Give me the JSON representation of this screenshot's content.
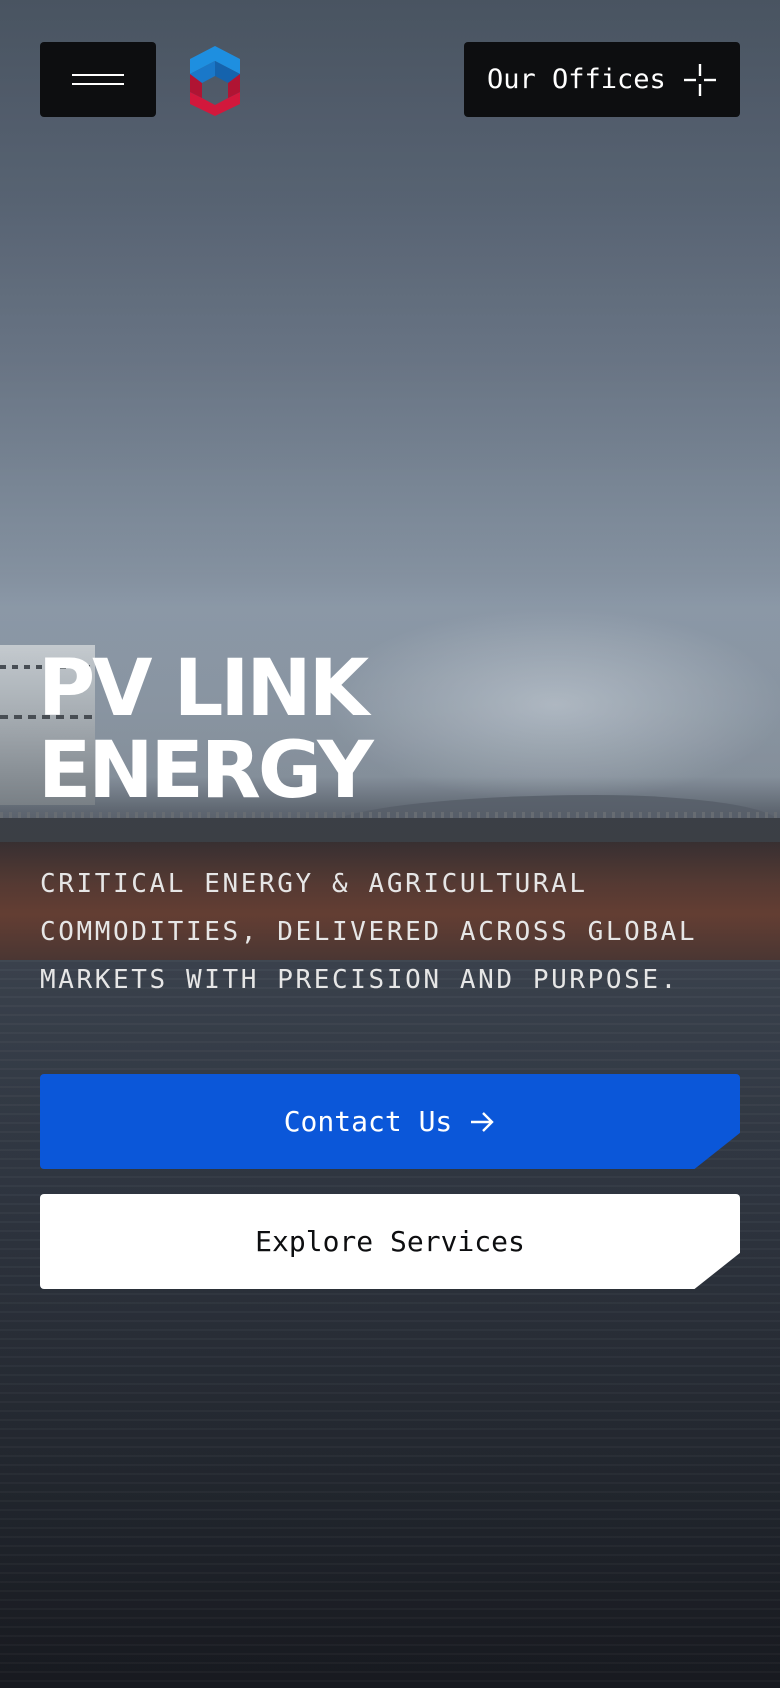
{
  "header": {
    "menu_icon": "hamburger-menu-icon",
    "logo_icon": "cube-logo-icon",
    "offices_label": "Our Offices",
    "offices_icon": "crosshair-icon"
  },
  "hero": {
    "title_line1": "PV LINK",
    "title_line2": "ENERGY",
    "subtitle_lines": [
      "CRITICAL ENERGY & AGRICULTURAL",
      "COMMODITIES, DELIVERED ACROSS GLOBAL",
      "MARKETS WITH PRECISION AND PURPOSE."
    ]
  },
  "actions": {
    "contact_label": "Contact Us",
    "contact_icon": "arrow-right-icon",
    "explore_label": "Explore Services"
  },
  "colors": {
    "primary_button": "#0b57d9",
    "dark_button": "#0d0e10",
    "secondary_button": "#ffffff",
    "logo_blue": "#1e8fe0",
    "logo_red": "#d2183c"
  }
}
